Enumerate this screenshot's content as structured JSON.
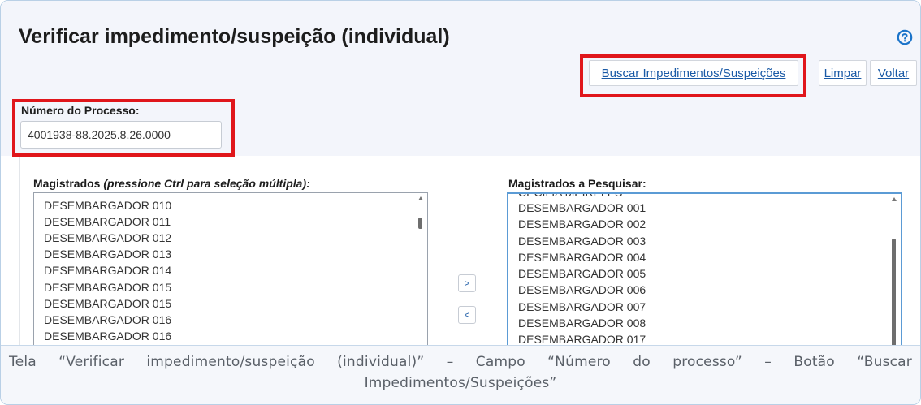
{
  "page": {
    "title": "Verificar impedimento/suspeição (individual)",
    "help_icon": "question-circle-icon"
  },
  "toolbar": {
    "buscar_label": "Buscar Impedimentos/Suspeições",
    "limpar_label": "Limpar",
    "voltar_label": "Voltar"
  },
  "processo": {
    "label": "Número do Processo:",
    "value": "4001938-88.2025.8.26.0000"
  },
  "magistrados": {
    "label_main": "Magistrados",
    "label_hint": "(pressione Ctrl para seleção múltipla):",
    "items": [
      "DESEMBARGADOR 010",
      "DESEMBARGADOR 011",
      "DESEMBARGADOR 012",
      "DESEMBARGADOR 013",
      "DESEMBARGADOR 014",
      "DESEMBARGADOR 015",
      "DESEMBARGADOR 015",
      "DESEMBARGADOR 016",
      "DESEMBARGADOR 016"
    ]
  },
  "move": {
    "add_label": ">",
    "remove_label": "<"
  },
  "pesquisar": {
    "label": "Magistrados a Pesquisar:",
    "partial_top_item": "CECILIA MEIRELES",
    "items": [
      "DESEMBARGADOR 001",
      "DESEMBARGADOR 002",
      "DESEMBARGADOR 003",
      "DESEMBARGADOR 004",
      "DESEMBARGADOR 005",
      "DESEMBARGADOR 006",
      "DESEMBARGADOR 007",
      "DESEMBARGADOR 008",
      "DESEMBARGADOR 017"
    ]
  },
  "caption": "Tela “Verificar impedimento/suspeição (individual)” – Campo “Número do processo” – Botão “Buscar Impedimentos/Suspeições”",
  "colors": {
    "highlight": "#e0161b",
    "link": "#1a5aa6",
    "help_icon": "#1a73c9"
  }
}
